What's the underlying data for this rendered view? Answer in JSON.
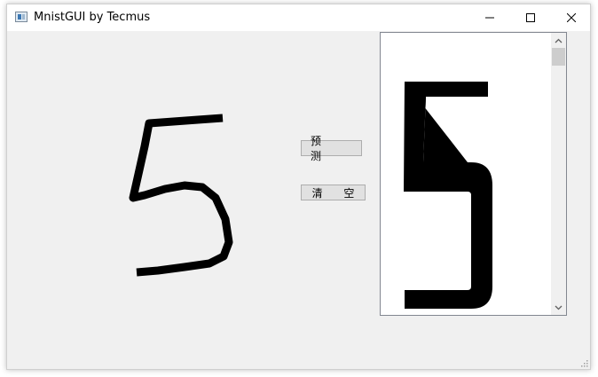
{
  "window": {
    "title": "MnistGUI by Tecmus",
    "controls": {
      "minimize_icon": "minimize-icon",
      "maximize_icon": "maximize-icon",
      "close_icon": "close-icon"
    }
  },
  "drawing_canvas": {
    "content": "handwritten digit stroke",
    "stroke_color": "#000000"
  },
  "buttons": {
    "predict_label": "预 测",
    "clear_label": "清 空"
  },
  "result": {
    "predicted_digit": "5",
    "scrollbar": {
      "up_icon": "chevron-up-icon",
      "down_icon": "chevron-down-icon"
    }
  },
  "colors": {
    "window_bg": "#f0f0f0",
    "titlebar_bg": "#ffffff",
    "button_bg": "#e1e1e1",
    "ink": "#000000"
  }
}
